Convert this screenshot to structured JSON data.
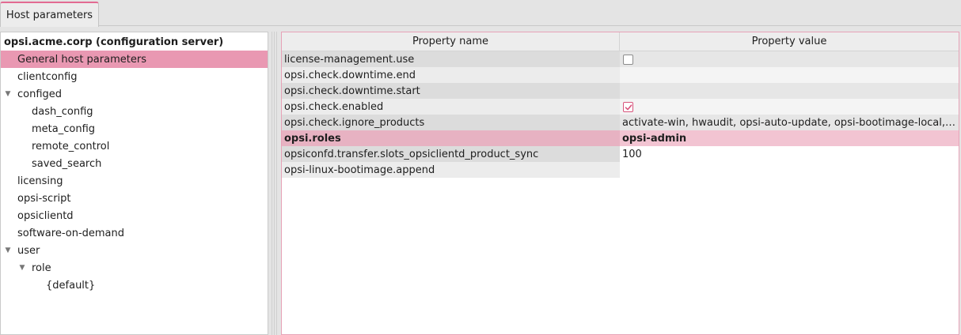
{
  "tabs": [
    {
      "label": "Host parameters",
      "active": true
    }
  ],
  "tree": {
    "root": "opsi.acme.corp (configuration server)",
    "items": [
      {
        "label": "General host parameters",
        "level": 1,
        "selected": true
      },
      {
        "label": "clientconfig",
        "level": 1
      },
      {
        "label": "configed",
        "level": 1,
        "expanded": true
      },
      {
        "label": "dash_config",
        "level": 2
      },
      {
        "label": "meta_config",
        "level": 2
      },
      {
        "label": "remote_control",
        "level": 2
      },
      {
        "label": "saved_search",
        "level": 2
      },
      {
        "label": "licensing",
        "level": 1
      },
      {
        "label": "opsi-script",
        "level": 1
      },
      {
        "label": "opsiclientd",
        "level": 1
      },
      {
        "label": "software-on-demand",
        "level": 1
      },
      {
        "label": "user",
        "level": 1,
        "expanded": true
      },
      {
        "label": "role",
        "level": 2,
        "expanded": true
      },
      {
        "label": "{default}",
        "level": 3
      }
    ]
  },
  "table": {
    "headers": {
      "name": "Property name",
      "value": "Property value"
    },
    "rows": [
      {
        "name": "license-management.use",
        "value": "",
        "checkbox": false
      },
      {
        "name": "opsi.check.downtime.end",
        "value": ""
      },
      {
        "name": "opsi.check.downtime.start",
        "value": ""
      },
      {
        "name": "opsi.check.enabled",
        "value": "",
        "checkbox": true
      },
      {
        "name": "opsi.check.ignore_products",
        "value": "activate-win, hwaudit, opsi-auto-update, opsi-bootimage-local, opsi-sc..."
      },
      {
        "name": "opsi.roles",
        "value": "opsi-admin",
        "selected": true
      },
      {
        "name": "opsiconfd.transfer.slots_opsiclientd_product_sync",
        "value": "100"
      },
      {
        "name": "opsi-linux-bootimage.append",
        "value": ""
      }
    ]
  },
  "colors": {
    "accent": "#e26b92",
    "selection": "#e998b2",
    "checkbox_checked": "#d8547c"
  }
}
